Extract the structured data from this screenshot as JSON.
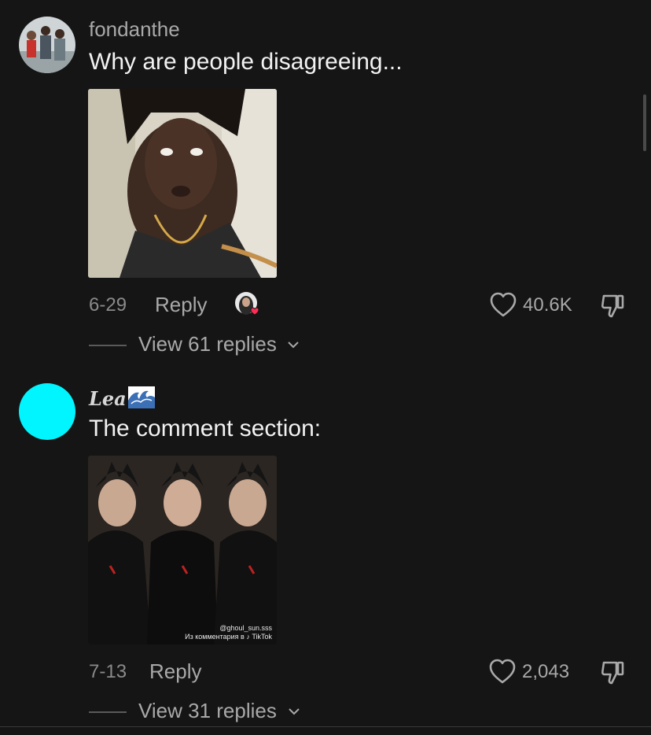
{
  "comments": [
    {
      "username": "fondanthe",
      "text": "Why are people disagreeing...",
      "date": "6-29",
      "reply_label": "Reply",
      "likes": "40.6K",
      "view_replies": "View 61 replies"
    },
    {
      "username": "Lea",
      "username_emoji": "wave-emoji",
      "text": "The comment section:",
      "date": "7-13",
      "reply_label": "Reply",
      "likes": "2,043",
      "view_replies": "View 31 replies",
      "media_caption_line1": "@ghoul_sun.sss",
      "media_caption_line2": "Из комментария в ♪ TikTok",
      "avatar_color": "#00f5ff"
    }
  ],
  "icons": [
    "heart-outline-icon",
    "thumbs-down-icon",
    "chevron-down-icon"
  ],
  "colors": {
    "background": "#151515",
    "muted_text": "#a9a9a9",
    "like_badge": "#ff2d55"
  }
}
